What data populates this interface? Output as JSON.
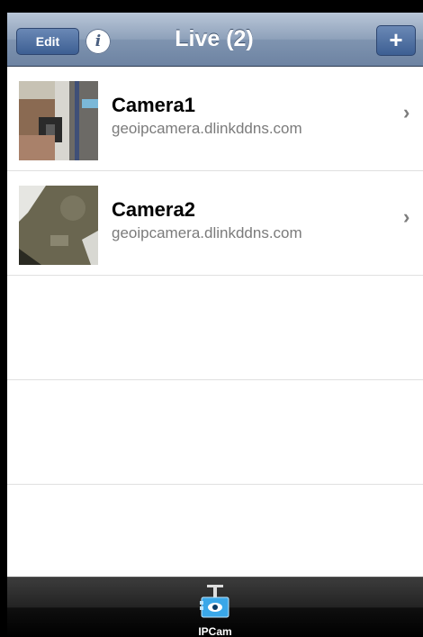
{
  "navbar": {
    "edit_label": "Edit",
    "title": "Live (2)",
    "add_label": "+",
    "info_label": "i"
  },
  "cameras": [
    {
      "name": "Camera1",
      "host": "geoipcamera.dlinkddns.com"
    },
    {
      "name": "Camera2",
      "host": "geoipcamera.dlinkddns.com"
    }
  ],
  "tabbar": {
    "items": [
      {
        "label": "IPCam",
        "icon": "ipcam-icon"
      }
    ]
  },
  "colors": {
    "nav_accent": "#7f94b0",
    "tab_icon": "#3aa7e8"
  }
}
